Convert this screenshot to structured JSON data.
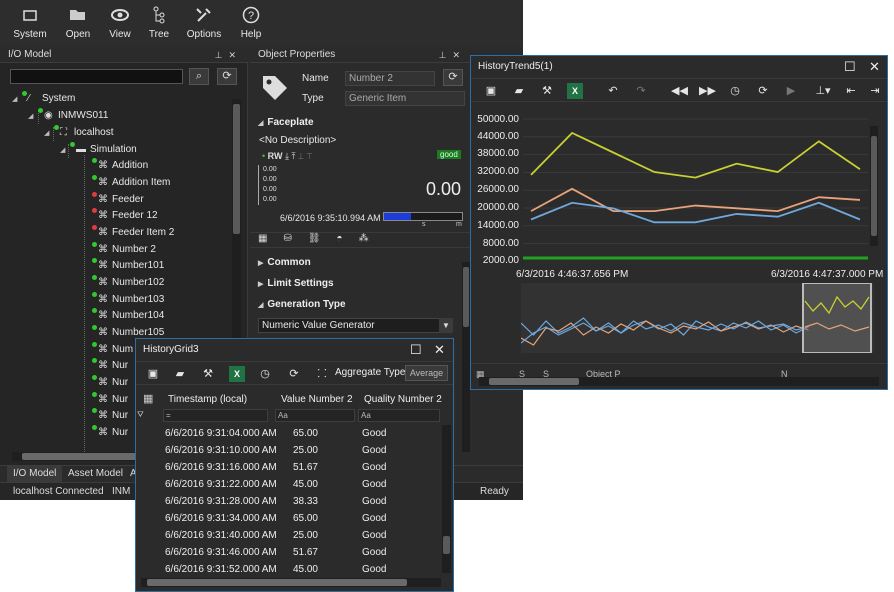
{
  "toolbar": {
    "items": [
      {
        "label": "System",
        "icon": "system-icon"
      },
      {
        "label": "Open",
        "icon": "folder-open-icon"
      },
      {
        "label": "View",
        "icon": "eye-icon"
      },
      {
        "label": "Tree",
        "icon": "tree-icon"
      },
      {
        "label": "Options",
        "icon": "tools-icon"
      },
      {
        "label": "Help",
        "icon": "help-icon"
      }
    ]
  },
  "io_model": {
    "title": "I/O Model",
    "tree": [
      {
        "label": "System"
      },
      {
        "label": "INMWS011"
      },
      {
        "label": "localhost"
      },
      {
        "label": "Simulation"
      },
      {
        "label": "Addition"
      },
      {
        "label": "Addition Item"
      },
      {
        "label": "Feeder"
      },
      {
        "label": "Feeder 12"
      },
      {
        "label": "Feeder Item 2"
      },
      {
        "label": "Number 2"
      },
      {
        "label": "Number101"
      },
      {
        "label": "Number102"
      },
      {
        "label": "Number103"
      },
      {
        "label": "Number104"
      },
      {
        "label": "Number105"
      },
      {
        "label": "Num"
      },
      {
        "label": "Nur"
      },
      {
        "label": "Nur"
      },
      {
        "label": "Nur"
      },
      {
        "label": "Nur"
      },
      {
        "label": "Nur"
      }
    ]
  },
  "bottom_tabs": [
    "I/O Model",
    "Asset Model",
    "A"
  ],
  "status": {
    "connection": "localhost  Connected",
    "server": "INM",
    "ready": "Ready"
  },
  "object_properties": {
    "title": "Object Properties",
    "name_label": "Name",
    "name_value": "Number 2",
    "type_label": "Type",
    "type_value": "Generic Item",
    "faceplate": "Faceplate",
    "description": "<No Description>",
    "quality_badge": "good",
    "ticks": [
      "0.00",
      "0.00",
      "0.00",
      "0.00"
    ],
    "value": "0.00",
    "timestamp": "6/6/2016 9:35:10.994 AM",
    "scale_labels": [
      "s",
      "m"
    ],
    "sections": [
      "Common",
      "Limit Settings",
      "Generation Type"
    ],
    "generator": "Numeric Value Generator"
  },
  "history_grid": {
    "title": "HistoryGrid3",
    "aggregate_label": "Aggregate Type",
    "aggregate_value": "Average",
    "columns": [
      "Timestamp (local)",
      "Value Number 2",
      "Quality Number 2"
    ],
    "rows": [
      {
        "ts": "6/6/2016 9:31:04.000 AM",
        "value": "65.00",
        "quality": "Good"
      },
      {
        "ts": "6/6/2016 9:31:10.000 AM",
        "value": "25.00",
        "quality": "Good"
      },
      {
        "ts": "6/6/2016 9:31:16.000 AM",
        "value": "51.67",
        "quality": "Good"
      },
      {
        "ts": "6/6/2016 9:31:22.000 AM",
        "value": "45.00",
        "quality": "Good"
      },
      {
        "ts": "6/6/2016 9:31:28.000 AM",
        "value": "38.33",
        "quality": "Good"
      },
      {
        "ts": "6/6/2016 9:31:34.000 AM",
        "value": "65.00",
        "quality": "Good"
      },
      {
        "ts": "6/6/2016 9:31:40.000 AM",
        "value": "25.00",
        "quality": "Good"
      },
      {
        "ts": "6/6/2016 9:31:46.000 AM",
        "value": "51.67",
        "quality": "Good"
      },
      {
        "ts": "6/6/2016 9:31:52.000 AM",
        "value": "45.00",
        "quality": "Good"
      }
    ]
  },
  "history_trend": {
    "title": "HistoryTrend5(1)",
    "y_ticks": [
      "50000.00",
      "44000.00",
      "38000.00",
      "32000.00",
      "26000.00",
      "20000.00",
      "14000.00",
      "8000.00",
      "2000.00"
    ],
    "start_time": "6/3/2016 4:46:37.656 PM",
    "end_time": "6/3/2016 4:47:37.000 PM",
    "colors": {
      "yellow": "#c8cf32",
      "orange": "#e8a37a",
      "blue": "#6fa8dc",
      "green": "#22a022"
    },
    "bottom_text": [
      "S",
      "S",
      "Object P",
      "",
      "N"
    ]
  },
  "chart_data": {
    "type": "line",
    "title": "",
    "ylim": [
      0,
      50000
    ],
    "x": [
      0,
      1,
      2,
      3,
      4,
      5,
      6,
      7,
      8
    ],
    "series": [
      {
        "values": [
          30000,
          45000,
          38000,
          31000,
          29000,
          34000,
          31000,
          42000,
          32000
        ]
      },
      {
        "values": [
          17000,
          25000,
          17000,
          17000,
          19000,
          18000,
          17000,
          22000,
          21000
        ]
      },
      {
        "values": [
          14000,
          20000,
          18000,
          13000,
          13000,
          16000,
          15000,
          20000,
          14000
        ]
      }
    ]
  }
}
